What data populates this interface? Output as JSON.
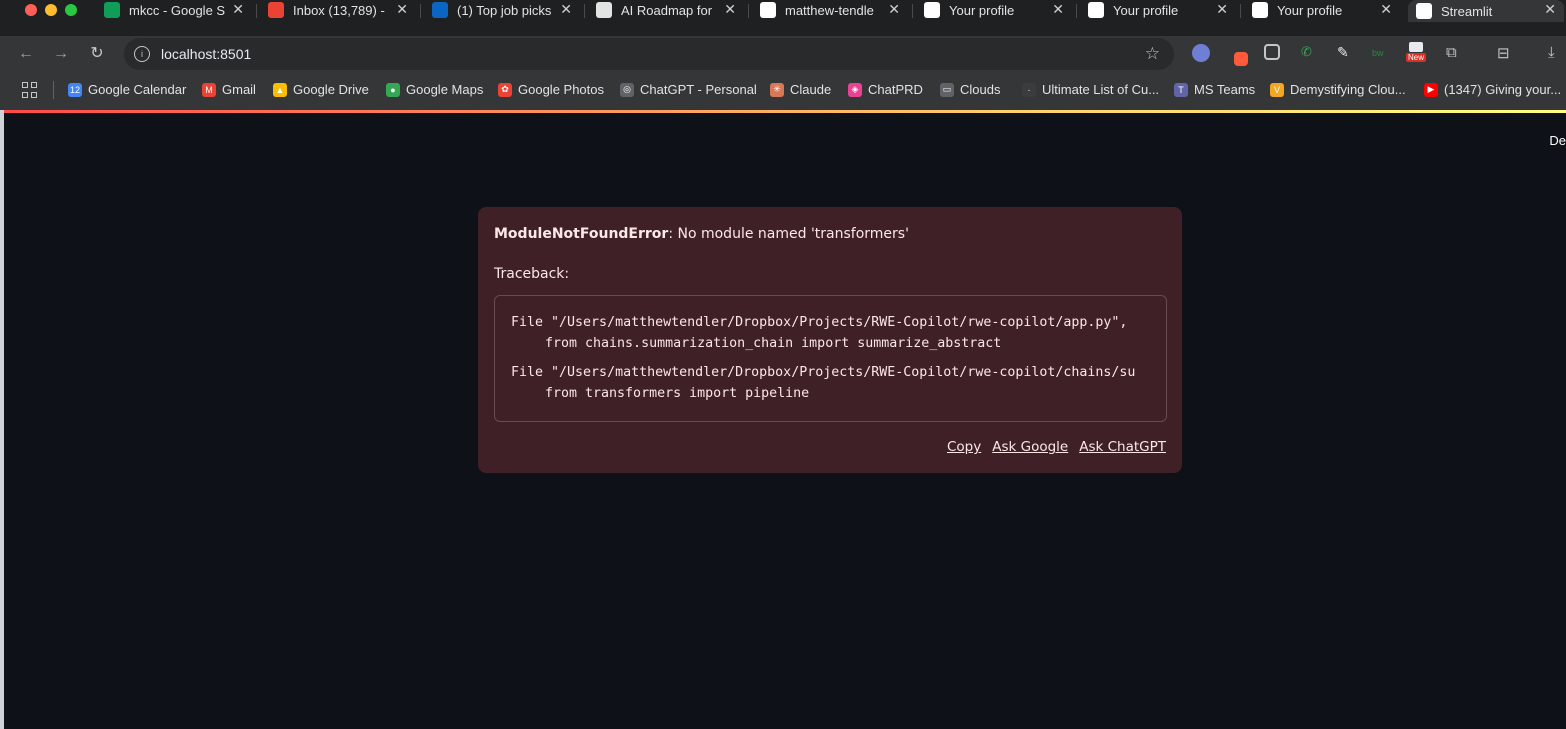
{
  "browser": {
    "tabs": [
      {
        "title": "mkcc - Google S",
        "icon": "google-sheets-icon",
        "color": "#0f9d58"
      },
      {
        "title": "Inbox (13,789) -",
        "icon": "gmail-icon",
        "color": "#ea4335"
      },
      {
        "title": "(1) Top job picks",
        "icon": "linkedin-icon",
        "color": "#0a66c2"
      },
      {
        "title": "AI Roadmap for",
        "icon": "chatgpt-icon",
        "color": "#e3e3e3"
      },
      {
        "title": "matthew-tendle",
        "icon": "github-icon",
        "color": "#ffffff"
      },
      {
        "title": "Your profile",
        "icon": "github-icon",
        "color": "#ffffff"
      },
      {
        "title": "Your profile",
        "icon": "github-icon",
        "color": "#ffffff"
      },
      {
        "title": "Your profile",
        "icon": "github-icon",
        "color": "#ffffff"
      },
      {
        "title": "Streamlit",
        "icon": "streamlit-icon",
        "color": "#ffffff"
      }
    ],
    "close_glyph": "✕",
    "url": "localhost:8501",
    "new_badge": "New"
  },
  "bookmarks": [
    {
      "label": "Google Calendar",
      "icon": "google-calendar-icon",
      "color": "#4285f4",
      "glyph": "12"
    },
    {
      "label": "Gmail",
      "icon": "gmail-icon",
      "color": "#ea4335",
      "glyph": "M"
    },
    {
      "label": "Google Drive",
      "icon": "google-drive-icon",
      "color": "#fbbc04",
      "glyph": "▲"
    },
    {
      "label": "Google Maps",
      "icon": "google-maps-icon",
      "color": "#34a853",
      "glyph": "●"
    },
    {
      "label": "Google Photos",
      "icon": "google-photos-icon",
      "color": "#ea4335",
      "glyph": "✿"
    },
    {
      "label": "ChatGPT - Personal",
      "icon": "chatgpt-icon",
      "color": "#5f6368",
      "glyph": "◎"
    },
    {
      "label": "Claude",
      "icon": "claude-icon",
      "color": "#d97757",
      "glyph": "✳"
    },
    {
      "label": "ChatPRD",
      "icon": "chatprd-icon",
      "color": "#e84393",
      "glyph": "◈"
    },
    {
      "label": "Clouds",
      "icon": "folder-icon",
      "color": "#5f6368",
      "glyph": "▭"
    },
    {
      "label": "Ultimate List of Cu...",
      "icon": "bookmark-icon",
      "color": "#3c3c3c",
      "glyph": "·"
    },
    {
      "label": "MS Teams",
      "icon": "ms-teams-icon",
      "color": "#6264a7",
      "glyph": "T"
    },
    {
      "label": "Demystifying Clou...",
      "icon": "medium-icon",
      "color": "#f5a623",
      "glyph": "V"
    },
    {
      "label": "(1347) Giving your...",
      "icon": "youtube-icon",
      "color": "#ff0000",
      "glyph": "▶"
    }
  ],
  "app": {
    "deploy_label": "De",
    "error": {
      "type": "ModuleNotFoundError",
      "message": ": No module named 'transformers'",
      "traceback_label": "Traceback:",
      "lines": [
        "File \"/Users/matthewtendler/Dropbox/Projects/RWE-Copilot/rwe-copilot/app.py\",",
        "from chains.summarization_chain import summarize_abstract",
        "File \"/Users/matthewtendler/Dropbox/Projects/RWE-Copilot/rwe-copilot/chains/su",
        "from transformers import pipeline"
      ],
      "actions": [
        "Copy",
        "Ask Google",
        "Ask ChatGPT"
      ]
    }
  }
}
